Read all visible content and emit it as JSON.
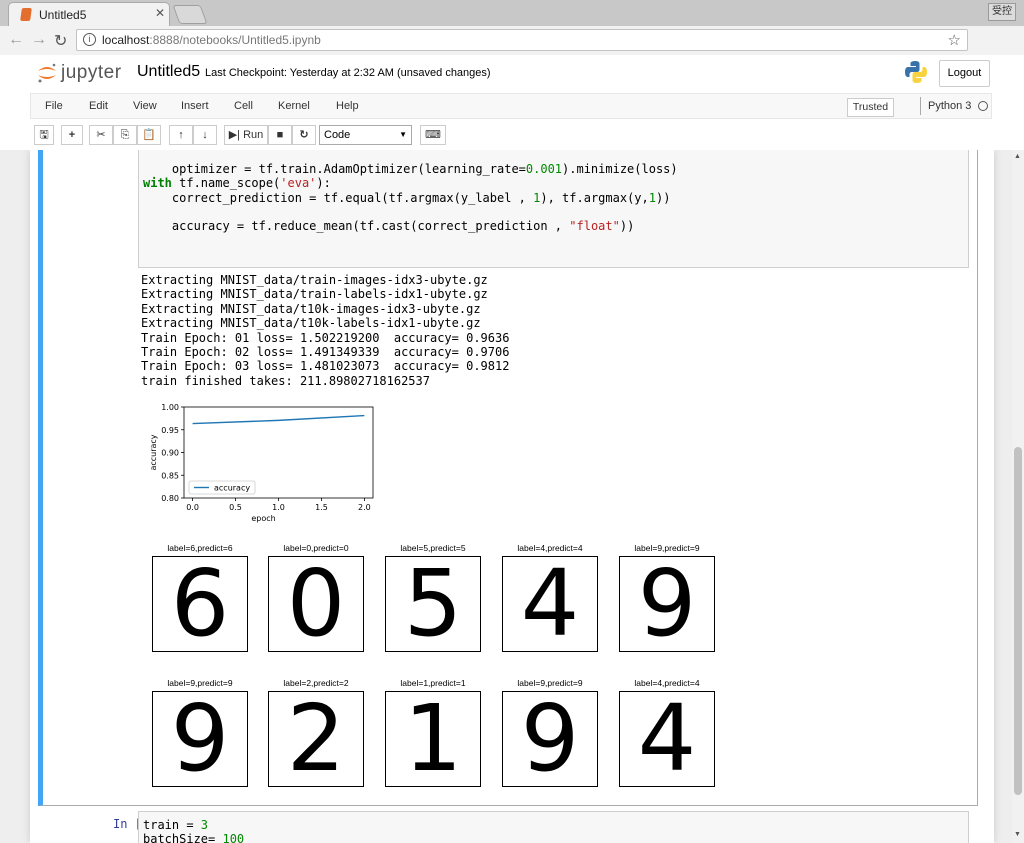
{
  "browser": {
    "tab_title": "Untitled5",
    "tab_close": "✕",
    "window_badge": "受控",
    "url_host": "localhost",
    "url_rest": ":8888/notebooks/Untitled5.ipynb",
    "star": "☆"
  },
  "jupyter": {
    "logo_text": "jupyter",
    "notebook_name": "Untitled5",
    "checkpoint": "Last Checkpoint: Yesterday at 2:32 AM   (unsaved changes)",
    "logout_label": "Logout",
    "menu": [
      "File",
      "Edit",
      "View",
      "Insert",
      "Cell",
      "Kernel",
      "Help"
    ],
    "trusted_label": "Trusted",
    "kernel_name": "Python 3",
    "toolbar": {
      "save": "🖫",
      "add": "+",
      "cut": "✂",
      "copy": "⎘",
      "paste": "📋",
      "up": "↑",
      "down": "↓",
      "run": "▶| Run",
      "stop": "■",
      "restart": "↻",
      "cell_type": "Code",
      "keyboard": "⌨"
    }
  },
  "cell": {
    "code_lines": [
      {
        "pre": "    optimizer = tf.train.AdamOptimizer(learning_rate=",
        "num": "0.001",
        "post": ").minimize(loss)"
      },
      {
        "kw": "with",
        "post": " tf.name_scope(",
        "str": "'eva'",
        "post2": "):"
      },
      {
        "pre": "    correct_prediction = tf.equal(tf.argmax(y_label , ",
        "num": "1",
        "mid": "), tf.argmax(y,",
        "num2": "1",
        "post": "))"
      },
      {
        "pre": "    accuracy = tf.reduce_mean(tf.cast(correct_prediction , ",
        "str": "\"float\"",
        "post": "))"
      }
    ],
    "output_lines": [
      "Extracting MNIST_data/train-images-idx3-ubyte.gz",
      "Extracting MNIST_data/train-labels-idx1-ubyte.gz",
      "Extracting MNIST_data/t10k-images-idx3-ubyte.gz",
      "Extracting MNIST_data/t10k-labels-idx1-ubyte.gz",
      "Train Epoch: 01 loss= 1.502219200  accuracy= 0.9636",
      "Train Epoch: 02 loss= 1.491349339  accuracy= 0.9706",
      "Train Epoch: 03 loss= 1.481023073  accuracy= 0.9812",
      "train finished takes: 211.89802718162537"
    ]
  },
  "chart_data": {
    "type": "line",
    "x": [
      0.0,
      1.0,
      2.0
    ],
    "series": [
      {
        "name": "accuracy",
        "values": [
          0.9636,
          0.9706,
          0.9812
        ],
        "color": "#1f77b4"
      }
    ],
    "xlabel": "epoch",
    "ylabel": "accuracy",
    "xticks": [
      "0.0",
      "0.5",
      "1.0",
      "1.5",
      "2.0"
    ],
    "yticks": [
      "0.80",
      "0.85",
      "0.90",
      "0.95",
      "1.00"
    ],
    "xlim": [
      -0.1,
      2.1
    ],
    "ylim": [
      0.8,
      1.0
    ],
    "legend": "lower-left",
    "grid": false
  },
  "digits": [
    {
      "title": "label=6,predict=6",
      "glyph": "6"
    },
    {
      "title": "label=0,predict=0",
      "glyph": "0"
    },
    {
      "title": "label=5,predict=5",
      "glyph": "5"
    },
    {
      "title": "label=4,predict=4",
      "glyph": "4"
    },
    {
      "title": "label=9,predict=9",
      "glyph": "9"
    },
    {
      "title": "label=9,predict=9",
      "glyph": "9"
    },
    {
      "title": "label=2,predict=2",
      "glyph": "2"
    },
    {
      "title": "label=1,predict=1",
      "glyph": "1"
    },
    {
      "title": "label=9,predict=9",
      "glyph": "9"
    },
    {
      "title": "label=4,predict=4",
      "glyph": "4"
    }
  ],
  "next_cell": {
    "prompt": "In [ ]:",
    "line1_pre": "train = ",
    "line1_num": "3",
    "line2_pre": "batchSize= ",
    "line2_num": "100"
  }
}
